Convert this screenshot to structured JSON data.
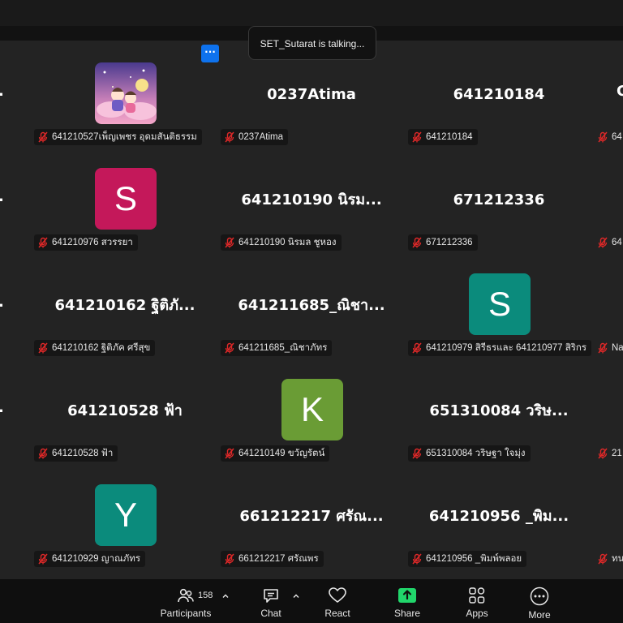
{
  "colors": {
    "accent": "#0e72ed",
    "share": "#21d66b",
    "mic_off": "#e02828"
  },
  "talking": "SET_Sutarat is talking...",
  "tiles": [
    {
      "big": "",
      "label": "641210527เพ็ญเพชร อุดมสันติธรรม",
      "avatar": "image"
    },
    {
      "big": "0237Atima",
      "label": "0237Atima"
    },
    {
      "big": "641210184",
      "label": "641210184"
    },
    {
      "big": "",
      "label": "641210976 สวรรยา",
      "avatar": "letter",
      "letter": "S",
      "color": "#c4185a"
    },
    {
      "big": "641210190 นิรม...",
      "label": "641210190 นิรมล ชูหอง"
    },
    {
      "big": "671212336",
      "label": "671212336"
    },
    {
      "big": "641210162 ฐิติภั...",
      "label": "641210162 ฐิติภัค ศรีสุข"
    },
    {
      "big": "641211685_ณิชา...",
      "label": "641211685_ณิชาภัทร"
    },
    {
      "big": "",
      "label": "641210979 สิรีธรและ 641210977 สิริกร",
      "avatar": "letter",
      "letter": "S",
      "color": "#0b8b7c"
    },
    {
      "big": "641210528 ฟ้า",
      "label": "641210528 ฟ้า"
    },
    {
      "big": "",
      "label": "641210149 ขวัญรัตน์",
      "avatar": "letter",
      "letter": "K",
      "color": "#6a9c35"
    },
    {
      "big": "651310084 วริษ...",
      "label": "651310084 วริษฐา ใจมุ่ง"
    },
    {
      "big": "",
      "label": "641210929 ญาณภัทร",
      "avatar": "letter",
      "letter": "Y",
      "color": "#0b8b7c"
    },
    {
      "big": "661212217 ศรัณ...",
      "label": "661212217 ศรัณพร"
    },
    {
      "big": "641210956 _พิม...",
      "label": "641210956 _พิมพ์พลอย"
    }
  ],
  "edge_right": [
    "64",
    "64",
    "Na",
    "21",
    "ทน"
  ],
  "edge_right_big": "C",
  "edge_left_dot": ".",
  "toolbar": {
    "participants_count": "158",
    "participants": "Participants",
    "chat": "Chat",
    "react": "React",
    "share": "Share",
    "apps": "Apps",
    "more": "More"
  }
}
